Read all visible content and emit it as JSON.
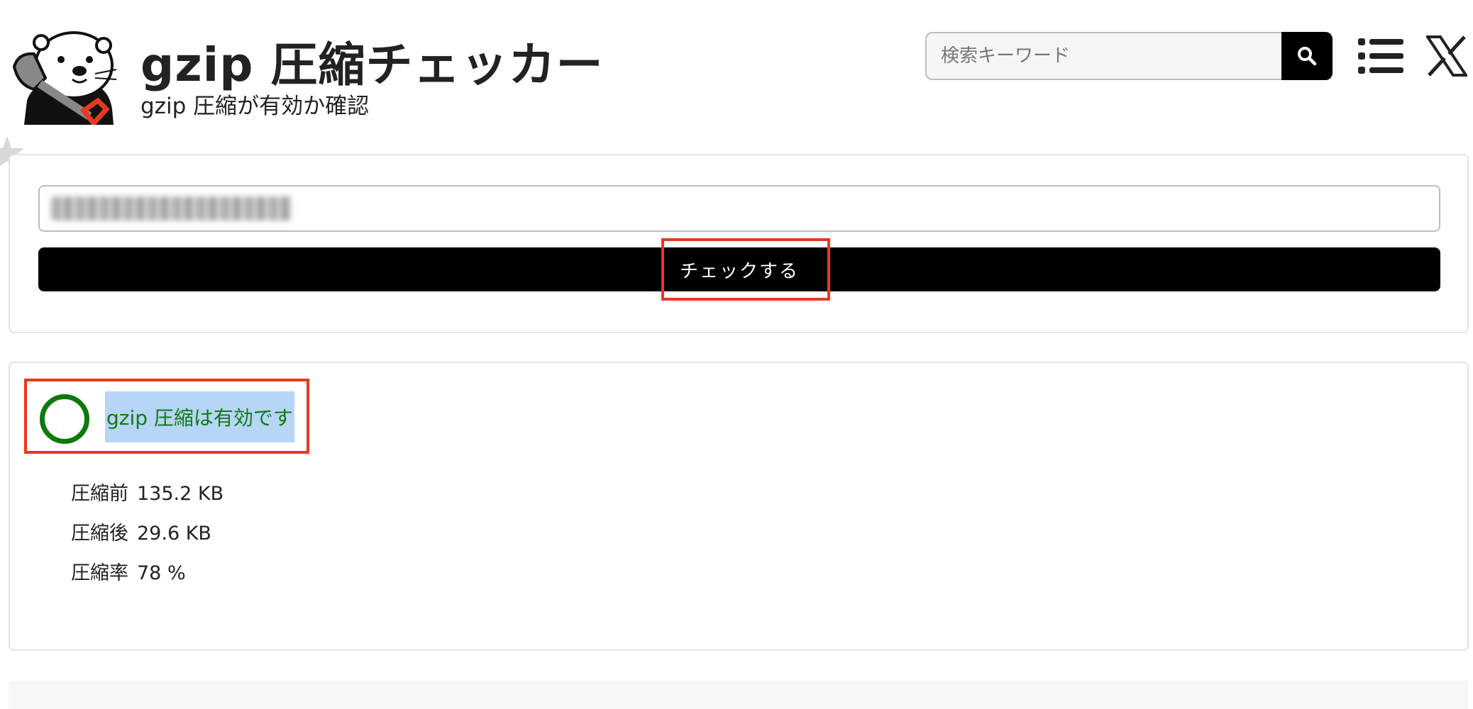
{
  "header": {
    "logo_icon": "otter-with-shovel-icon",
    "title": "gzip 圧縮チェッカー",
    "subtitle": "gzip 圧縮が有効か確認",
    "search": {
      "placeholder": "検索キーワード",
      "button_icon": "search-icon"
    },
    "menu_icon": "list-menu-icon",
    "social_icon": "x-icon"
  },
  "form": {
    "url_value": "",
    "submit_label": "チェックする"
  },
  "result": {
    "status_icon": "ok-circle-icon",
    "status_text": "gzip 圧縮は有効です",
    "status_color": "#117a11",
    "stats": [
      {
        "label": "圧縮前",
        "value": "135.2 KB"
      },
      {
        "label": "圧縮後",
        "value": "29.6 KB"
      },
      {
        "label": "圧縮率",
        "value": "78 %"
      }
    ]
  },
  "colors": {
    "highlight_border": "#e8391f",
    "text_selection": "#b6d5f7",
    "button_bg": "#000000"
  }
}
